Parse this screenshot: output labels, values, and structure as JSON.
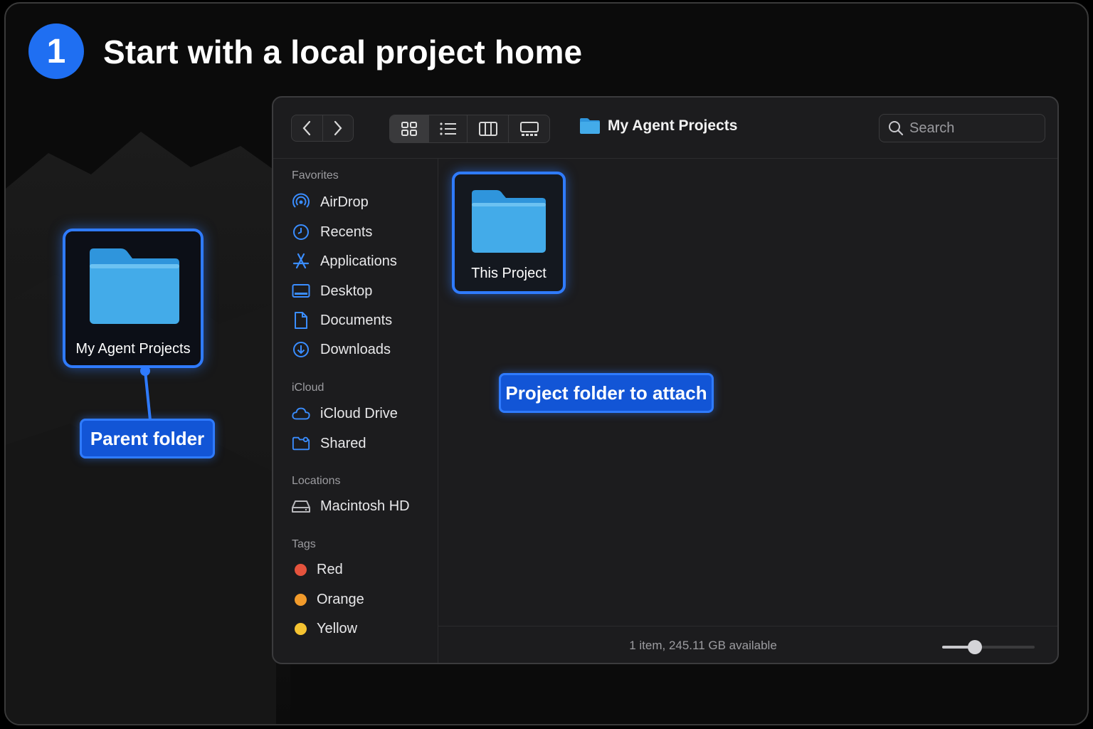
{
  "step": {
    "number": "1",
    "title": "Start with a local project home"
  },
  "parent": {
    "folder_label": "My Agent Projects",
    "callout": "Parent folder"
  },
  "project": {
    "folder_label": "This Project",
    "callout": "Project folder to attach"
  },
  "finder": {
    "path_title": "My Agent Projects",
    "search": {
      "placeholder": "Search",
      "value": ""
    },
    "views": [
      "icon-view",
      "list-view",
      "column-view",
      "gallery-view"
    ],
    "active_view": "icon-view",
    "sidebar": {
      "favorites_header": "Favorites",
      "favorites": [
        {
          "label": "AirDrop",
          "icon": "airdrop-icon"
        },
        {
          "label": "Recents",
          "icon": "clock-icon"
        },
        {
          "label": "Applications",
          "icon": "applications-icon"
        },
        {
          "label": "Desktop",
          "icon": "desktop-icon"
        },
        {
          "label": "Documents",
          "icon": "document-icon"
        },
        {
          "label": "Downloads",
          "icon": "download-icon"
        }
      ],
      "icloud_header": "iCloud",
      "icloud": [
        {
          "label": "iCloud Drive",
          "icon": "cloud-icon"
        },
        {
          "label": "Shared",
          "icon": "shared-folder-icon"
        }
      ],
      "locations_header": "Locations",
      "locations": [
        {
          "label": "Macintosh HD",
          "icon": "hard-drive-icon"
        }
      ],
      "tags_header": "Tags",
      "tags": [
        {
          "label": "Red",
          "color": "#e5533d"
        },
        {
          "label": "Orange",
          "color": "#f29b2b"
        },
        {
          "label": "Yellow",
          "color": "#f5c331"
        }
      ]
    },
    "status_text": "1 item, 245.11 GB available",
    "zoom_level": 0.35
  },
  "colors": {
    "accent": "#2f7bff",
    "badge": "#1f6ff2",
    "folder": "#3fa6e6"
  }
}
